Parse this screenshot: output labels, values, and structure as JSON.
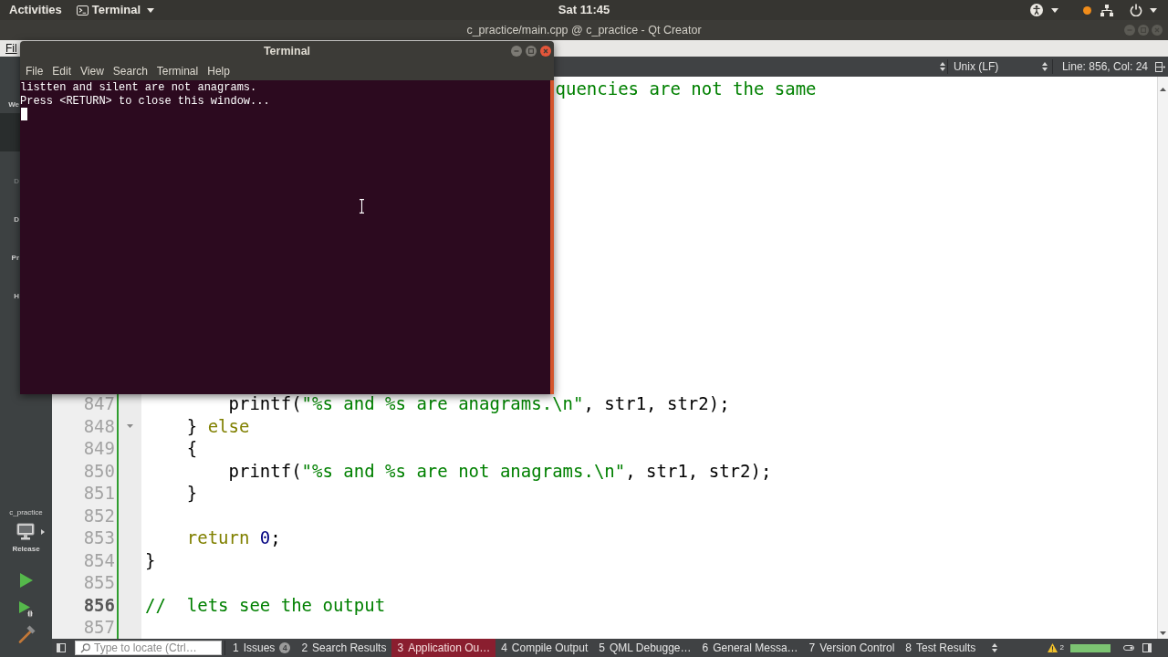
{
  "top_bar": {
    "activities": "Activities",
    "app_menu": "Terminal",
    "clock": "Sat 11:45"
  },
  "qt_window": {
    "title": "c_practice/main.cpp @ c_practice - Qt Creator",
    "menu": [
      "Fil"
    ],
    "modes": [
      {
        "label": "We",
        "selected": false,
        "disabled": false
      },
      {
        "selected": true,
        "disabled": false
      },
      {
        "label": "D",
        "selected": false,
        "disabled": true
      },
      {
        "label": "D",
        "selected": false,
        "disabled": false
      },
      {
        "label": "Pr",
        "selected": false,
        "disabled": false
      },
      {
        "label": "H",
        "selected": false,
        "disabled": false
      }
    ],
    "target": {
      "project": "c_practice",
      "build": "Release"
    },
    "editor_toolbar": {
      "line_ending": "Unix (LF)",
      "position": "Line: 856, Col: 24"
    },
    "editor": {
      "partial_line": {
        "text": "quencies are not the same",
        "kind": "comment"
      },
      "lines": [
        {
          "number": "847",
          "current": false,
          "fold_marker": false,
          "tokens": [
            {
              "text": "        printf(",
              "kind": "plain"
            },
            {
              "text": "\"%s and %s are anagrams.\\n\"",
              "kind": "string"
            },
            {
              "text": ", str1, str2);",
              "kind": "plain"
            }
          ]
        },
        {
          "number": "848",
          "current": false,
          "fold_marker": true,
          "tokens": [
            {
              "text": "    } ",
              "kind": "plain"
            },
            {
              "text": "else",
              "kind": "keyword"
            }
          ]
        },
        {
          "number": "849",
          "current": false,
          "fold_marker": false,
          "tokens": [
            {
              "text": "    {",
              "kind": "plain"
            }
          ]
        },
        {
          "number": "850",
          "current": false,
          "fold_marker": false,
          "tokens": [
            {
              "text": "        printf(",
              "kind": "plain"
            },
            {
              "text": "\"%s and %s are not anagrams.\\n\"",
              "kind": "string"
            },
            {
              "text": ", str1, str2);",
              "kind": "plain"
            }
          ]
        },
        {
          "number": "851",
          "current": false,
          "fold_marker": false,
          "tokens": [
            {
              "text": "    }",
              "kind": "plain"
            }
          ]
        },
        {
          "number": "852",
          "current": false,
          "fold_marker": false
        },
        {
          "number": "853",
          "current": false,
          "fold_marker": false,
          "tokens": [
            {
              "text": "    return",
              "kind": "keyword"
            },
            {
              "text": " 0",
              "kind": "number"
            },
            {
              "text": ";",
              "kind": "plain"
            }
          ]
        },
        {
          "number": "854",
          "current": false,
          "fold_marker": false,
          "tokens": [
            {
              "text": "}",
              "kind": "plain"
            }
          ]
        },
        {
          "number": "855",
          "current": false,
          "fold_marker": false
        },
        {
          "number": "856",
          "current": true,
          "fold_marker": false,
          "tokens": [
            {
              "text": "//  lets see the output",
              "kind": "comment"
            }
          ]
        },
        {
          "number": "857",
          "current": false,
          "fold_marker": false
        }
      ]
    },
    "bottom_bar": {
      "locator": {
        "placeholder": "Type to locate (Ctrl…"
      },
      "tabs": [
        {
          "number": "1",
          "label": "Issues",
          "badge": "4",
          "selected": false
        },
        {
          "number": "2",
          "label": "Search Results",
          "selected": false
        },
        {
          "number": "3",
          "label": "Application Ou…",
          "selected": true
        },
        {
          "number": "4",
          "label": "Compile Output",
          "selected": false
        },
        {
          "number": "5",
          "label": "QML Debugge…",
          "selected": false
        },
        {
          "number": "6",
          "label": "General Messa…",
          "selected": false
        },
        {
          "number": "7",
          "label": "Version Control",
          "selected": false
        },
        {
          "number": "8",
          "label": "Test Results",
          "selected": false
        }
      ],
      "warnings": "2",
      "progress": {
        "level": 1
      }
    }
  },
  "terminal": {
    "title": "Terminal",
    "menu": [
      "File",
      "Edit",
      "View",
      "Search",
      "Terminal",
      "Help"
    ],
    "output": [
      "listten and silent are not anagrams.",
      "Press <RETURN> to close this window..."
    ]
  }
}
